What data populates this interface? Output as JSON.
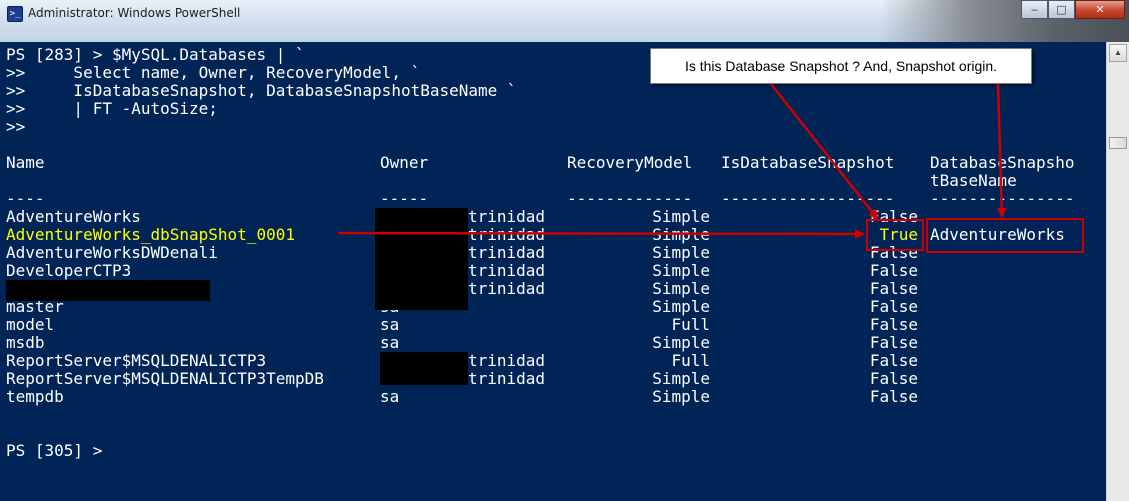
{
  "window": {
    "title": "Administrator: Windows PowerShell",
    "icon_glyph": ">_",
    "controls": {
      "minimize": "‒",
      "maximize": "□",
      "close": "✕"
    }
  },
  "console": {
    "prompt_lines": [
      "PS [283] > $MySQL.Databases | `",
      ">>     Select name, Owner, RecoveryModel, `",
      ">>     IsDatabaseSnapshot, DatabaseSnapshotBaseName `",
      ">>     | FT -AutoSize;",
      ">>"
    ],
    "headers": {
      "name": "Name",
      "owner": "Owner",
      "recovery_model": "RecoveryModel",
      "is_snapshot": "IsDatabaseSnapshot",
      "base_name_1": "DatabaseSnapsho",
      "base_name_2": "tBaseName"
    },
    "separators": {
      "name": "----",
      "owner": "-----",
      "recovery_model": "-------------",
      "is_snapshot": "------------------",
      "base_name": "---------------"
    },
    "rows": [
      {
        "name": "AdventureWorks",
        "owner": "trinidad",
        "recovery": "Simple",
        "snapshot": "False",
        "base": ""
      },
      {
        "name": "AdventureWorks_dbSnapShot_0001",
        "owner": "trinidad",
        "recovery": "Simple",
        "snapshot": "True",
        "base": "AdventureWorks"
      },
      {
        "name": "AdventureWorksDWDenali",
        "owner": "trinidad",
        "recovery": "Simple",
        "snapshot": "False",
        "base": ""
      },
      {
        "name": "DeveloperCTP3",
        "owner": "trinidad",
        "recovery": "Simple",
        "snapshot": "False",
        "base": ""
      },
      {
        "name": "",
        "owner": "trinidad",
        "recovery": "Simple",
        "snapshot": "False",
        "base": ""
      },
      {
        "name": "master",
        "owner": "sa",
        "recovery": "Simple",
        "snapshot": "False",
        "base": ""
      },
      {
        "name": "model",
        "owner": "sa",
        "recovery": "Full",
        "snapshot": "False",
        "base": ""
      },
      {
        "name": "msdb",
        "owner": "sa",
        "recovery": "Simple",
        "snapshot": "False",
        "base": ""
      },
      {
        "name": "ReportServer$MSQLDENALICTP3",
        "owner": "trinidad",
        "recovery": "Full",
        "snapshot": "False",
        "base": ""
      },
      {
        "name": "ReportServer$MSQLDENALICTP3TempDB",
        "owner": "trinidad",
        "recovery": "Simple",
        "snapshot": "False",
        "base": ""
      },
      {
        "name": "tempdb",
        "owner": "sa",
        "recovery": "Simple",
        "snapshot": "False",
        "base": ""
      }
    ],
    "final_prompt": "PS [305] >"
  },
  "annotation": {
    "callout_text": "Is this Database Snapshot ? And, Snapshot origin."
  },
  "colors": {
    "console_background": "#012456",
    "console_text": "#ffffff",
    "highlight_text": "#ffff00",
    "annotation_red": "#cc0000"
  },
  "icons": {
    "app": "powershell-icon",
    "minimize": "minimize-icon",
    "maximize": "maximize-icon",
    "close": "close-icon",
    "scroll_up": "scroll-up-arrow-icon"
  }
}
